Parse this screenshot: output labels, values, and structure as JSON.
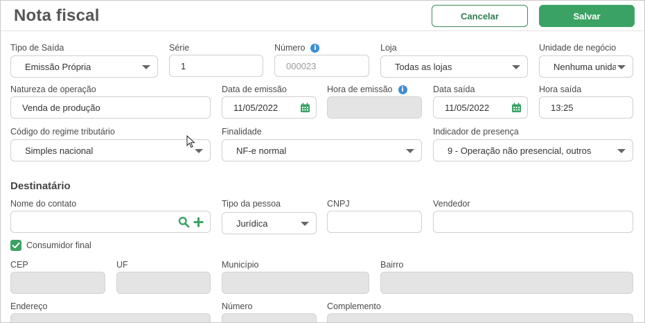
{
  "header": {
    "title": "Nota fiscal",
    "cancel_label": "Cancelar",
    "save_label": "Salvar"
  },
  "row1": {
    "tipo_saida": {
      "label": "Tipo de Saída",
      "value": "Emissão Própria"
    },
    "serie": {
      "label": "Série",
      "value": "1"
    },
    "numero": {
      "label": "Número",
      "placeholder": "000023",
      "info_icon": "info-icon"
    },
    "loja": {
      "label": "Loja",
      "value": "Todas as lojas"
    },
    "unidade": {
      "label": "Unidade de negócio",
      "value": "Nenhuma unidade"
    }
  },
  "row2": {
    "natureza": {
      "label": "Natureza de operação",
      "value": "Venda de produção"
    },
    "data_emissao": {
      "label": "Data de emissão",
      "value": "11/05/2022"
    },
    "hora_emissao": {
      "label": "Hora de emissão",
      "value": ""
    },
    "data_saida": {
      "label": "Data saída",
      "value": "11/05/2022"
    },
    "hora_saida": {
      "label": "Hora saída",
      "value": "13:25"
    }
  },
  "row3": {
    "regime": {
      "label": "Código do regime tributário",
      "value": "Simples nacional"
    },
    "finalidade": {
      "label": "Finalidade",
      "value": "NF-e normal"
    },
    "presenca": {
      "label": "Indicador de presença",
      "value": "9 - Operação não presencial, outros"
    }
  },
  "destinatario": {
    "title": "Destinatário",
    "nome_contato": {
      "label": "Nome do contato",
      "value": ""
    },
    "tipo_pessoa": {
      "label": "Tipo da pessoa",
      "value": "Jurídica"
    },
    "cnpj": {
      "label": "CNPJ",
      "value": ""
    },
    "vendedor": {
      "label": "Vendedor",
      "value": ""
    },
    "consumidor_final": {
      "label": "Consumidor final",
      "checked": true
    },
    "cep": {
      "label": "CEP"
    },
    "uf": {
      "label": "UF"
    },
    "municipio": {
      "label": "Município"
    },
    "bairro": {
      "label": "Bairro"
    },
    "endereco": {
      "label": "Endereço"
    },
    "numero": {
      "label": "Número"
    },
    "complemento": {
      "label": "Complemento"
    }
  },
  "colors": {
    "accent_green": "#3aa364",
    "cancel_border": "#3a8a58",
    "info_blue": "#3d8fd6",
    "disabled_bg": "#e4e4e4"
  }
}
